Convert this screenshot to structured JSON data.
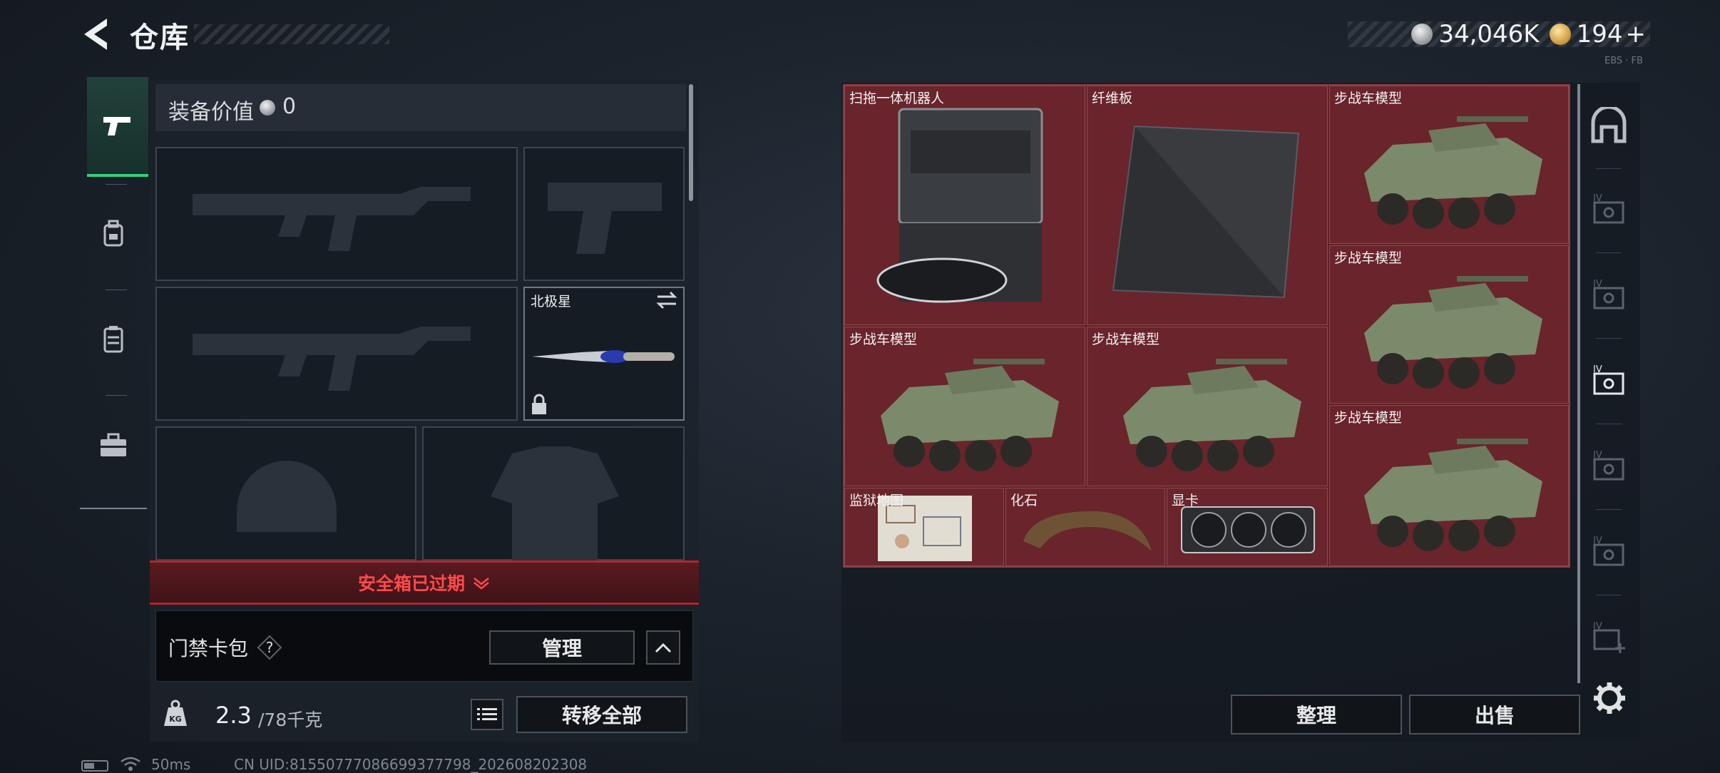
{
  "header": {
    "title": "仓库",
    "currency_silver": "34,046K",
    "currency_gold": "194",
    "currency_gold_plus": "+",
    "corner_text": "EBS · FB"
  },
  "equipment": {
    "value_label": "装备价值",
    "value": "0",
    "melee_name": "北极星",
    "safe_box_status": "安全箱已过期",
    "keycard_label": "门禁卡包",
    "help_glyph": "?",
    "manage_label": "管理",
    "weight_current": "2.3",
    "weight_max": "/78千克",
    "transfer_all_label": "转移全部"
  },
  "storage": {
    "items": [
      {
        "name": "扫拖一体机器人"
      },
      {
        "name": "纤维板"
      },
      {
        "name": "步战车模型"
      },
      {
        "name": "步战车模型"
      },
      {
        "name": "步战车模型"
      },
      {
        "name": "步战车模型"
      },
      {
        "name": "步战车模型"
      },
      {
        "name": "监狱地图"
      },
      {
        "name": "化石"
      },
      {
        "name": "显卡"
      }
    ],
    "sort_label": "整理",
    "sell_label": "出售",
    "rail_tier_label": "IV"
  },
  "status": {
    "ping": "50ms",
    "uid": "CN UID:81550777086699377798_202608202308"
  },
  "colors": {
    "accent_green": "#33d07e",
    "warning_red": "#ff4a4a",
    "storage_bg": "#6a242b"
  }
}
